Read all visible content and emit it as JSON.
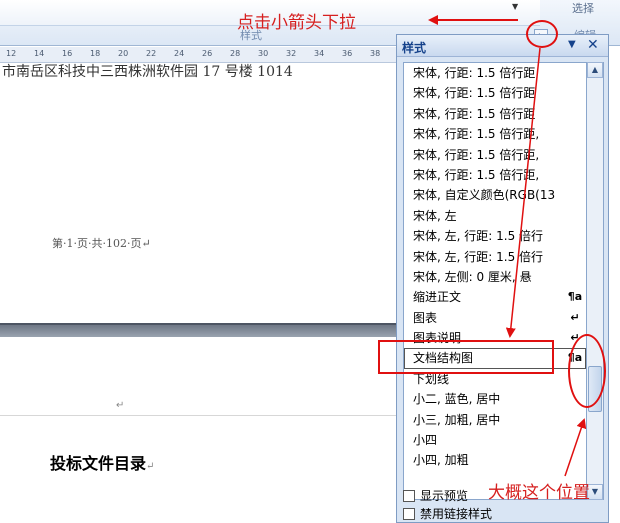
{
  "ribbon": {
    "group_label": "样式",
    "edit_label": "编辑",
    "right_label": "选择"
  },
  "ruler": {
    "ticks": [
      "12",
      "14",
      "16",
      "18",
      "20",
      "22",
      "24",
      "26",
      "28",
      "30",
      "32",
      "34",
      "36",
      "38"
    ]
  },
  "document": {
    "top_text": "市南岳区科技中三西株洲软件园 17 号楼 1014",
    "page_footer": "第·1·页·共·102·页↵",
    "para_mark": "↵",
    "heading": "投标文件目录",
    "heading_mark": "↵"
  },
  "styles_pane": {
    "title": "样式",
    "menu_glyph": "▼",
    "close_glyph": "✕",
    "items": [
      {
        "label": "宋体, 行距: 1.5 倍行距",
        "mark": ""
      },
      {
        "label": "宋体, 行距: 1.5 倍行距",
        "mark": ""
      },
      {
        "label": "宋体, 行距: 1.5 倍行距",
        "mark": ""
      },
      {
        "label": "宋体, 行距: 1.5 倍行距,",
        "mark": ""
      },
      {
        "label": "宋体, 行距: 1.5 倍行距,",
        "mark": ""
      },
      {
        "label": "宋体, 行距: 1.5 倍行距,",
        "mark": ""
      },
      {
        "label": "宋体, 自定义颜色(RGB(13",
        "mark": ""
      },
      {
        "label": "宋体, 左",
        "mark": ""
      },
      {
        "label": "宋体, 左, 行距: 1.5 倍行",
        "mark": ""
      },
      {
        "label": "宋体, 左, 行距: 1.5 倍行",
        "mark": ""
      },
      {
        "label": "宋体, 左侧: 0 厘米, 悬",
        "mark": ""
      },
      {
        "label": "缩进正文",
        "mark": "¶a"
      },
      {
        "label": "图表",
        "mark": "↵"
      },
      {
        "label": "图表说明",
        "mark": "↵"
      },
      {
        "label": "文档结构图",
        "mark": "¶a"
      },
      {
        "label": "下划线",
        "mark": ""
      },
      {
        "label": "小二, 蓝色, 居中",
        "mark": ""
      },
      {
        "label": "小三, 加粗, 居中",
        "mark": ""
      },
      {
        "label": "小四",
        "mark": ""
      },
      {
        "label": "小四, 加粗",
        "mark": ""
      }
    ],
    "selected_index": 14,
    "option_preview": "显示预览",
    "option_linked": "禁用链接样式"
  },
  "annotations": {
    "top": "点击小箭头下拉",
    "bottom": "大概这个位置"
  },
  "colors": {
    "annotation_red": "#e01010",
    "pane_blue": "#15428b"
  }
}
